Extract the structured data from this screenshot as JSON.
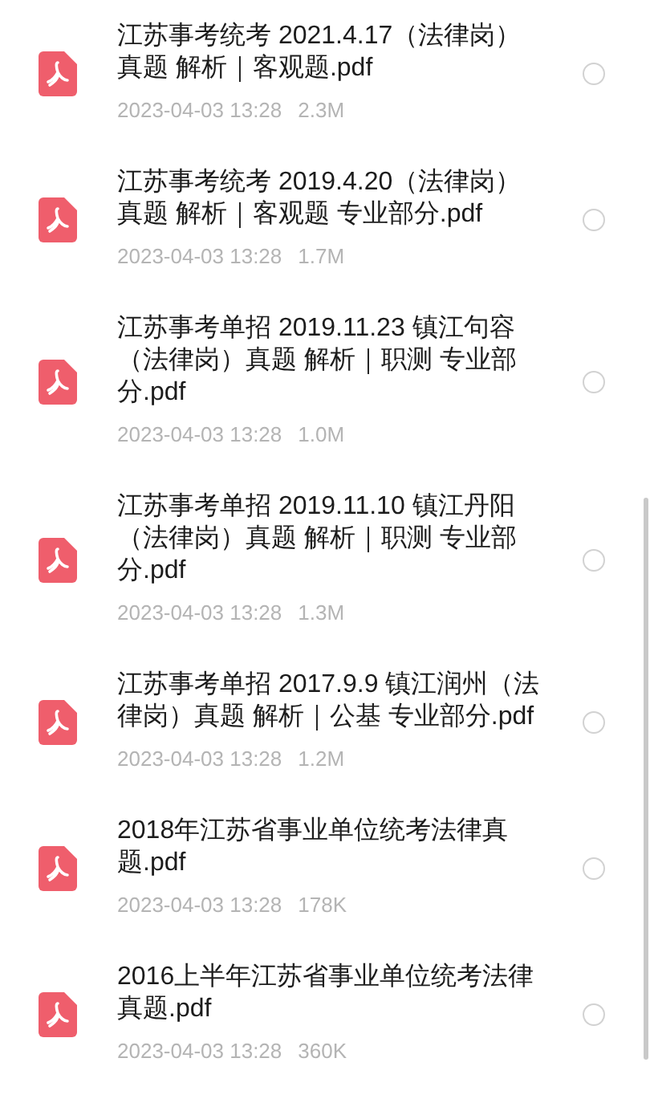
{
  "files": [
    {
      "name": "江苏事考统考 2021.4.17（法律岗）真题 解析｜客观题.pdf",
      "date": "2023-04-03 13:28",
      "size": "2.3M",
      "selected": false
    },
    {
      "name": "江苏事考统考 2019.4.20（法律岗）真题 解析｜客观题 专业部分.pdf",
      "date": "2023-04-03 13:28",
      "size": "1.7M",
      "selected": false
    },
    {
      "name": "江苏事考单招 2019.11.23 镇江句容（法律岗）真题 解析｜职测 专业部分.pdf",
      "date": "2023-04-03 13:28",
      "size": "1.0M",
      "selected": false
    },
    {
      "name": "江苏事考单招 2019.11.10 镇江丹阳（法律岗）真题 解析｜职测 专业部分.pdf",
      "date": "2023-04-03 13:28",
      "size": "1.3M",
      "selected": false
    },
    {
      "name": "江苏事考单招 2017.9.9 镇江润州（法律岗）真题 解析｜公基 专业部分.pdf",
      "date": "2023-04-03 13:28",
      "size": "1.2M",
      "selected": false
    },
    {
      "name": "2018年江苏省事业单位统考法律真题.pdf",
      "date": "2023-04-03 13:28",
      "size": "178K",
      "selected": false
    },
    {
      "name": "2016上半年江苏省事业单位统考法律真题.pdf",
      "date": "2023-04-03 13:28",
      "size": "360K",
      "selected": false
    }
  ]
}
